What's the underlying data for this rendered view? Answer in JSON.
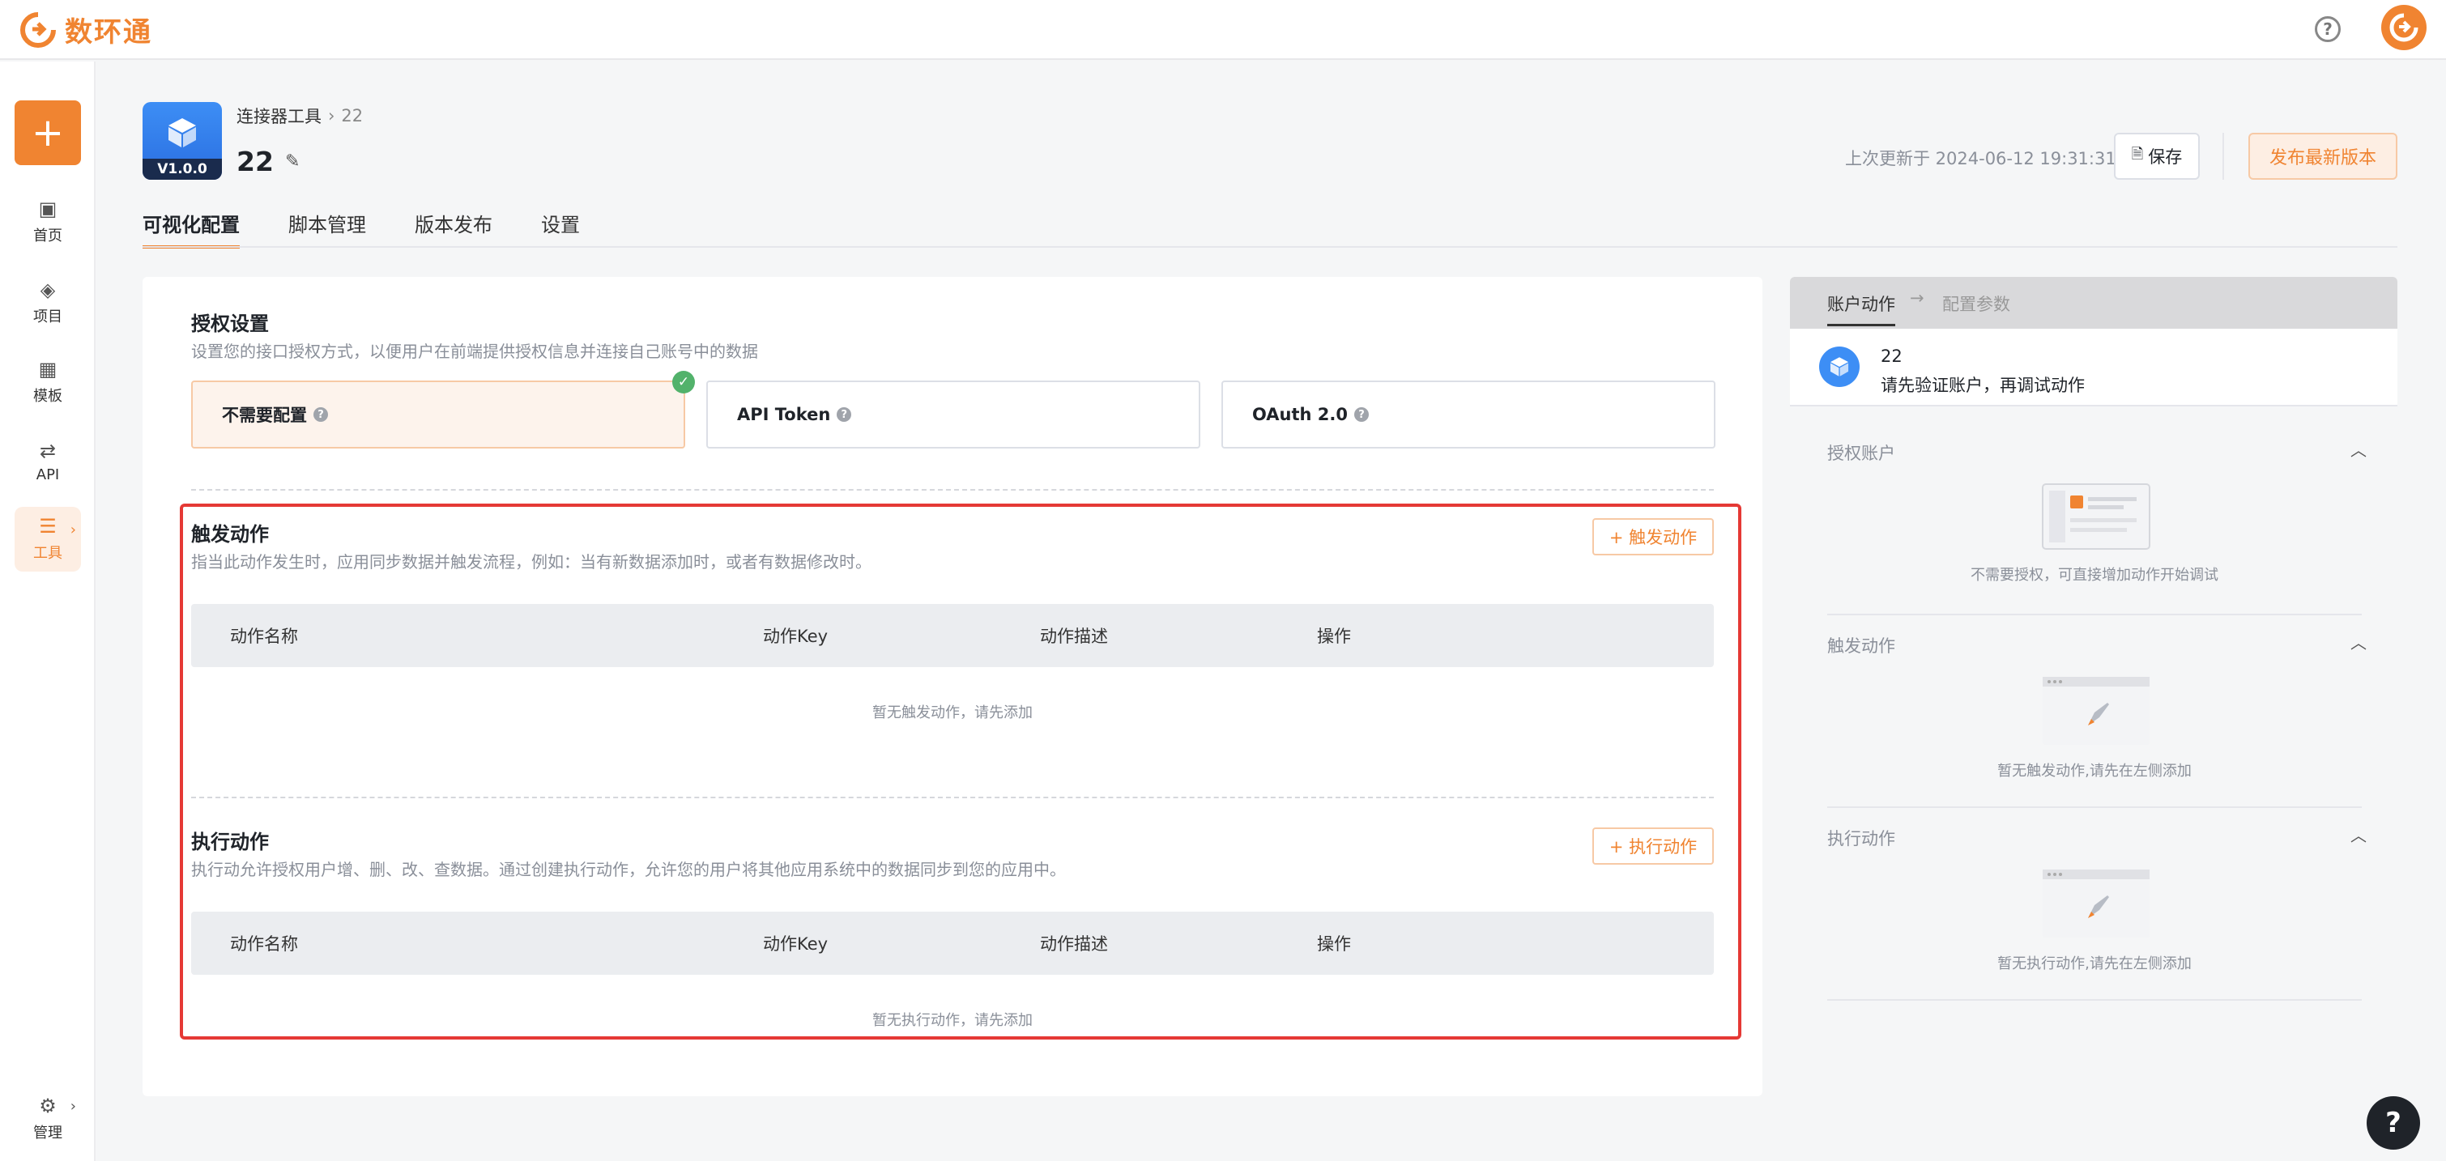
{
  "brand": {
    "name": "数环通",
    "accent": "#f08431"
  },
  "sidebar": {
    "add_label": "+",
    "items": [
      {
        "label": "首页",
        "icon": "home-icon"
      },
      {
        "label": "项目",
        "icon": "layers-icon"
      },
      {
        "label": "模板",
        "icon": "grid-icon"
      },
      {
        "label": "API",
        "icon": "api-icon"
      },
      {
        "label": "工具",
        "icon": "tools-icon"
      }
    ],
    "manage_label": "管理"
  },
  "app": {
    "version": "V1.0.0",
    "breadcrumb_parent": "连接器工具",
    "breadcrumb_current": "22",
    "title": "22",
    "last_update": "上次更新于 2024-06-12 19:31:31",
    "save_label": "保存",
    "publish_label": "发布最新版本"
  },
  "tabs": [
    "可视化配置",
    "脚本管理",
    "版本发布",
    "设置"
  ],
  "auth": {
    "title": "授权设置",
    "desc": "设置您的接口授权方式，以便用户在前端提供授权信息并连接自己账号中的数据",
    "options": [
      "不需要配置",
      "API Token",
      "OAuth 2.0"
    ],
    "selected": 0
  },
  "trigger": {
    "title": "触发动作",
    "desc": "指当此动作发生时，应用同步数据并触发流程，例如：当有新数据添加时，或者有数据修改时。",
    "add_label": "+ 触发动作",
    "columns": [
      "动作名称",
      "动作Key",
      "动作描述",
      "操作"
    ],
    "empty": "暂无触发动作，请先添加"
  },
  "execute": {
    "title": "执行动作",
    "desc": "执行动允许授权用户增、删、改、查数据。通过创建执行动作，允许您的用户将其他应用系统中的数据同步到您的应用中。",
    "add_label": "+ 执行动作",
    "columns": [
      "动作名称",
      "动作Key",
      "动作描述",
      "操作"
    ],
    "empty": "暂无执行动作，请先添加"
  },
  "right_panel": {
    "tab1": "账户动作",
    "tab2": "配置参数",
    "card_name": "22",
    "card_msg": "请先验证账户，再调试动作",
    "sections": [
      {
        "title": "授权账户",
        "empty": "不需要授权，可直接增加动作开始调试"
      },
      {
        "title": "触发动作",
        "empty": "暂无触发动作,请先在左侧添加"
      },
      {
        "title": "执行动作",
        "empty": "暂无执行动作,请先在左侧添加"
      }
    ]
  },
  "fab_label": "?"
}
